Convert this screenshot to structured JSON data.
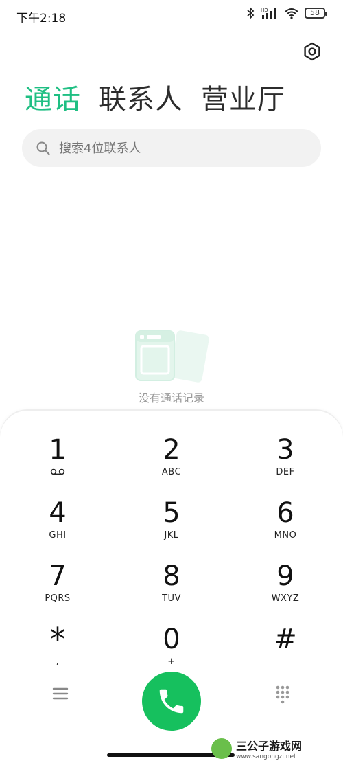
{
  "status_bar": {
    "time": "下午2:18",
    "battery": "58",
    "icons": [
      "bluetooth-icon",
      "hd-signal-icon",
      "wifi-icon",
      "battery-icon"
    ]
  },
  "header": {
    "tabs": [
      {
        "label": "通话",
        "active": true
      },
      {
        "label": "联系人",
        "active": false
      },
      {
        "label": "营业厅",
        "active": false
      }
    ],
    "settings_icon": "settings-icon"
  },
  "search": {
    "placeholder": "搜索4位联系人"
  },
  "empty_state": {
    "text": "没有通话记录"
  },
  "dialpad": {
    "keys": [
      {
        "digit": "1",
        "letters": "",
        "sub_icon": "voicemail-icon"
      },
      {
        "digit": "2",
        "letters": "ABC"
      },
      {
        "digit": "3",
        "letters": "DEF"
      },
      {
        "digit": "4",
        "letters": "GHI"
      },
      {
        "digit": "5",
        "letters": "JKL"
      },
      {
        "digit": "6",
        "letters": "MNO"
      },
      {
        "digit": "7",
        "letters": "PQRS"
      },
      {
        "digit": "8",
        "letters": "TUV"
      },
      {
        "digit": "9",
        "letters": "WXYZ"
      },
      {
        "digit": "*",
        "letters": ","
      },
      {
        "digit": "0",
        "letters": "+"
      },
      {
        "digit": "#",
        "letters": ""
      }
    ],
    "bottom": {
      "menu_icon": "menu-icon",
      "call_icon": "phone-icon",
      "keypad_icon": "dialpad-icon"
    }
  },
  "watermark": {
    "title": "三公子游戏网",
    "url": "www.sangongzi.net"
  },
  "colors": {
    "accent": "#1fbf83",
    "call": "#16c05e",
    "search_bg": "#f2f2f2"
  }
}
